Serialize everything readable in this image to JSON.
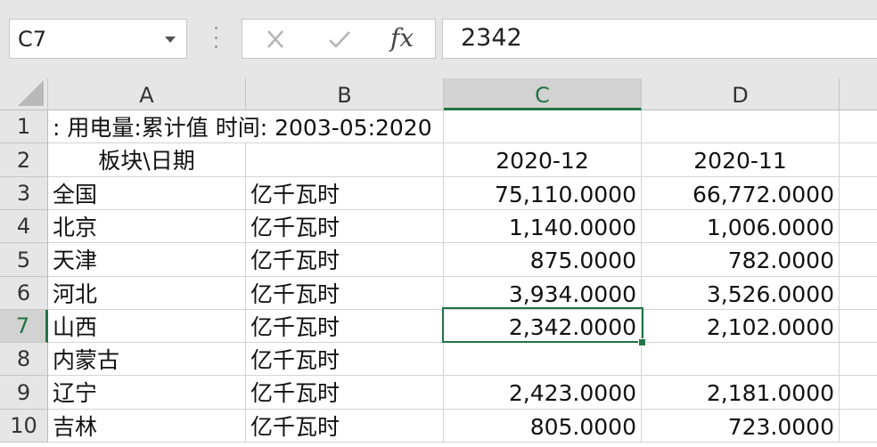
{
  "formula_bar": {
    "name_box": "C7",
    "formula": "2342",
    "fx_label": "fx"
  },
  "columns": [
    "A",
    "B",
    "C",
    "D"
  ],
  "selected_column": "C",
  "selected_row": "7",
  "rows": [
    {
      "num": "1",
      "a": ": 用电量:累计值  时间: 2003-05:2020",
      "b": "",
      "c": "",
      "d": ""
    },
    {
      "num": "2",
      "a": "板块\\日期",
      "b": "",
      "c": "2020-12",
      "d": "2020-11"
    },
    {
      "num": "3",
      "a": "全国",
      "b": "亿千瓦时",
      "c": "75,110.0000",
      "d": "66,772.0000"
    },
    {
      "num": "4",
      "a": "北京",
      "b": "亿千瓦时",
      "c": "1,140.0000",
      "d": "1,006.0000"
    },
    {
      "num": "5",
      "a": "天津",
      "b": "亿千瓦时",
      "c": "875.0000",
      "d": "782.0000"
    },
    {
      "num": "6",
      "a": "河北",
      "b": "亿千瓦时",
      "c": "3,934.0000",
      "d": "3,526.0000"
    },
    {
      "num": "7",
      "a": "山西",
      "b": "亿千瓦时",
      "c": "2,342.0000",
      "d": "2,102.0000"
    },
    {
      "num": "8",
      "a": "内蒙古",
      "b": "亿千瓦时",
      "c": "",
      "d": ""
    },
    {
      "num": "9",
      "a": "辽宁",
      "b": "亿千瓦时",
      "c": "2,423.0000",
      "d": "2,181.0000"
    },
    {
      "num": "10",
      "a": "吉林",
      "b": "亿千瓦时",
      "c": "805.0000",
      "d": "723.0000"
    }
  ],
  "colors": {
    "accent": "#217346",
    "header_bg": "#e6e6e6",
    "selected_header_bg": "#d2d2d2"
  },
  "icons": {
    "cancel": "close-icon",
    "confirm": "check-icon",
    "function": "fx-icon",
    "dropdown": "chevron-down-icon"
  }
}
